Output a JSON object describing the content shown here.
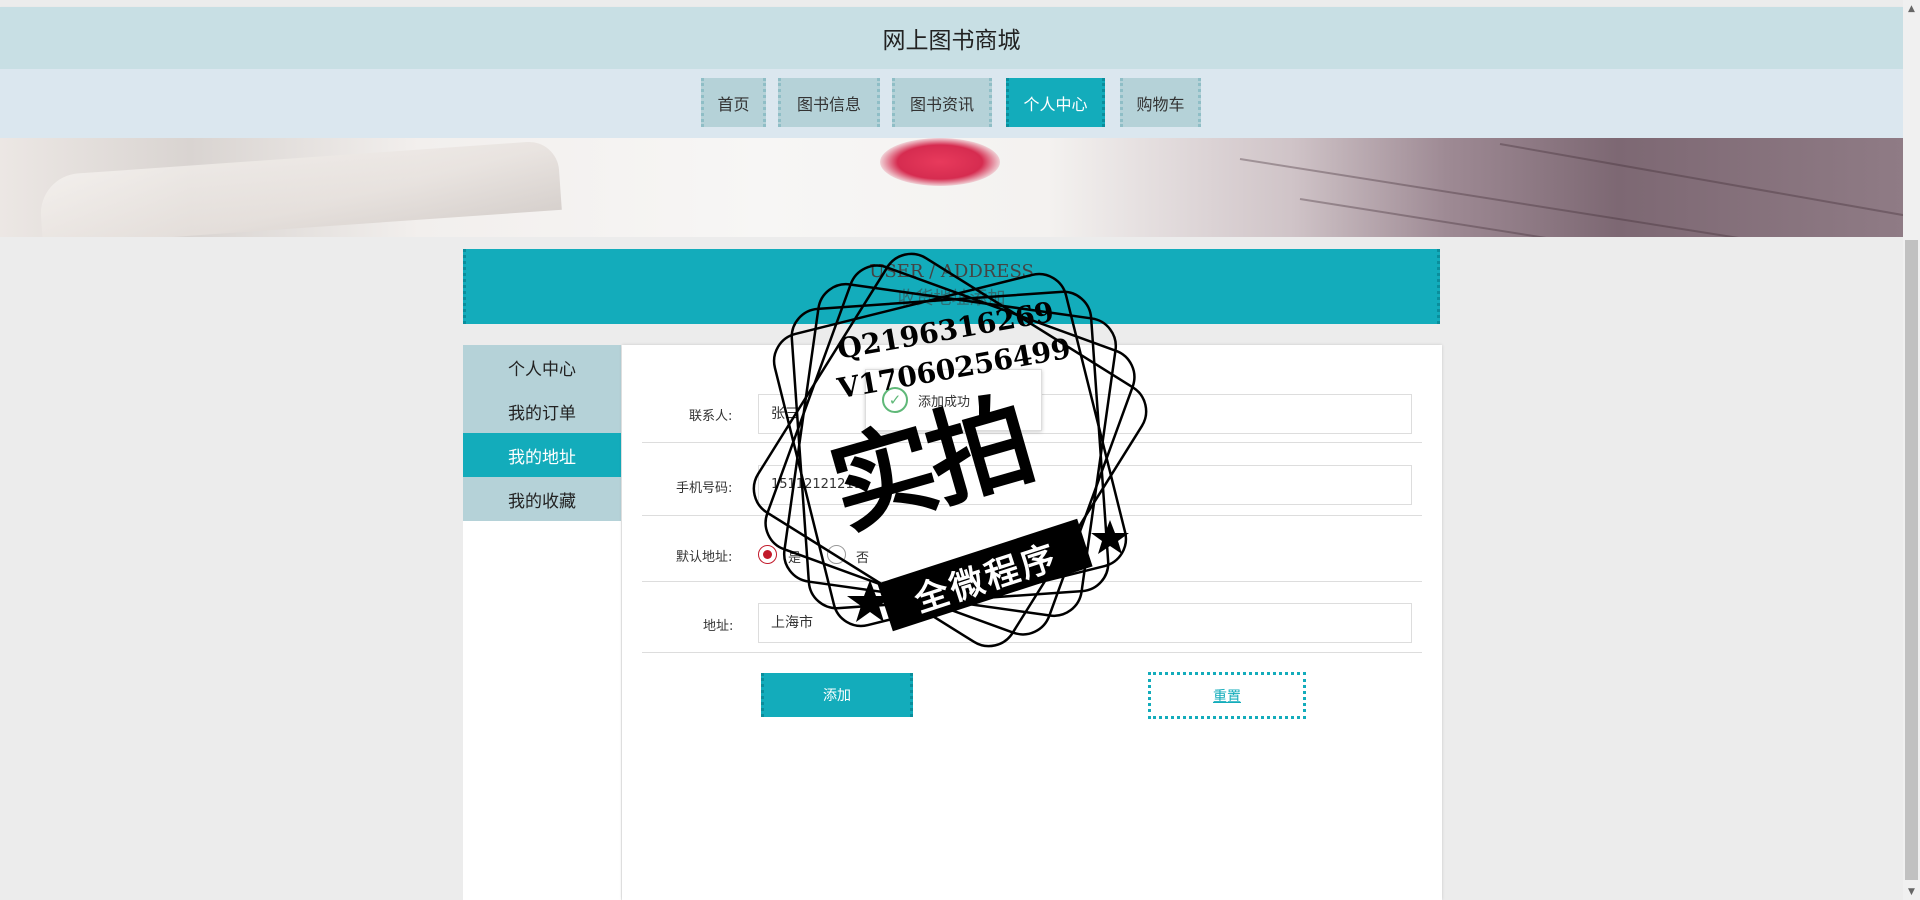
{
  "site": {
    "title": "网上图书商城"
  },
  "nav": {
    "items": [
      {
        "label": "首页"
      },
      {
        "label": "图书信息"
      },
      {
        "label": "图书资讯"
      },
      {
        "label": "个人中心"
      },
      {
        "label": "购物车"
      }
    ],
    "active": "个人中心"
  },
  "section": {
    "title_en": "USER / ADDRESS",
    "title_zh": "收货地址添加"
  },
  "sidebar": {
    "items": [
      {
        "label": "个人中心"
      },
      {
        "label": "我的订单"
      },
      {
        "label": "我的地址"
      },
      {
        "label": "我的收藏"
      }
    ],
    "active": "我的地址"
  },
  "form": {
    "contact_label": "联系人:",
    "contact_value": "张三",
    "phone_label": "手机号码:",
    "phone_value": "15112121211",
    "default_label": "默认地址:",
    "default_yes": "是",
    "default_no": "否",
    "default_selected": "是",
    "address_label": "地址:",
    "address_value": "上海市",
    "submit_label": "添加",
    "reset_label": "重置"
  },
  "toast": {
    "message": "添加成功"
  },
  "watermark": {
    "line1": "Q2196316269",
    "line2": "V17060256499",
    "main": "实拍",
    "ribbon": "全微程序"
  },
  "colors": {
    "accent": "#13acbb",
    "header_bg": "#c8dfe4",
    "nav_bg": "#dbe7ef",
    "item_bg": "#b5d2d8",
    "radio_checked": "#c21a2b",
    "success": "#5fb878"
  }
}
